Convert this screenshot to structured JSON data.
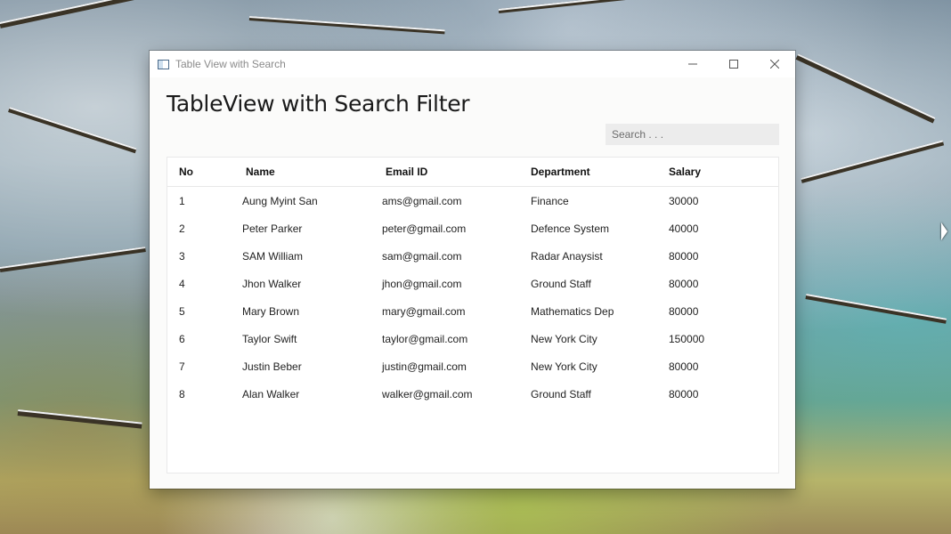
{
  "window": {
    "title": "Table View with Search"
  },
  "page": {
    "heading": "TableView with Search Filter"
  },
  "search": {
    "placeholder": "Search . . .",
    "value": ""
  },
  "table": {
    "columns": [
      "No",
      "Name",
      "Email ID",
      "Department",
      "Salary"
    ],
    "rows": [
      [
        "1",
        "Aung Myint San",
        "ams@gmail.com",
        "Finance",
        "30000"
      ],
      [
        "2",
        "Peter Parker",
        "peter@gmail.com",
        "Defence System",
        "40000"
      ],
      [
        "3",
        "SAM William",
        "sam@gmail.com",
        "Radar Anaysist",
        "80000"
      ],
      [
        "4",
        "Jhon Walker",
        "jhon@gmail.com",
        "Ground Staff",
        "80000"
      ],
      [
        "5",
        "Mary Brown",
        "mary@gmail.com",
        "Mathematics Dep",
        "80000"
      ],
      [
        "6",
        "Taylor Swift",
        "taylor@gmail.com",
        "New York City",
        "150000"
      ],
      [
        "7",
        "Justin Beber",
        "justin@gmail.com",
        "New York City",
        "80000"
      ],
      [
        "8",
        "Alan Walker",
        "walker@gmail.com",
        "Ground Staff",
        "80000"
      ]
    ]
  },
  "icons": {
    "app": "window-app-icon",
    "minimize": "minimize-icon",
    "maximize": "maximize-icon",
    "close": "close-icon"
  }
}
